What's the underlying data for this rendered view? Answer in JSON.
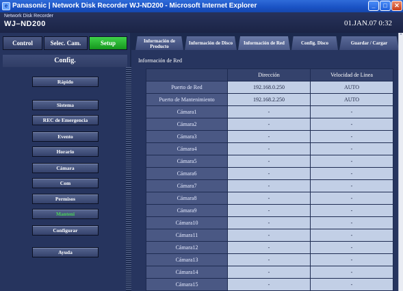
{
  "window": {
    "title": "Panasonic | Network Disk Recorder WJ-ND200 - Microsoft Internet Explorer",
    "min_glyph": "_",
    "max_glyph": "□",
    "close_glyph": "✕"
  },
  "header": {
    "product_line": "Network Disk Recorder",
    "model": "WJ–ND200",
    "datetime": "01.JAN.07  0:32"
  },
  "modes": {
    "control": "Control",
    "selec_cam": "Selec. Cam.",
    "setup": "Setup"
  },
  "sidebar": {
    "title": "Config.",
    "items": [
      {
        "label": "Rápido",
        "active": false
      },
      {
        "label": "Sistema",
        "active": false
      },
      {
        "label": "REC de Emergencia",
        "active": false
      },
      {
        "label": "Evento",
        "active": false
      },
      {
        "label": "Horario",
        "active": false
      },
      {
        "label": "Cámara",
        "active": false
      },
      {
        "label": "Com",
        "active": false
      },
      {
        "label": "Permisos",
        "active": false
      },
      {
        "label": "Manteni",
        "active": true
      },
      {
        "label": "Configurar",
        "active": false
      },
      {
        "label": "Ayuda",
        "active": false
      }
    ]
  },
  "tabs": {
    "producto_line1": "Información de",
    "producto_line2": "Producto",
    "disco": "Información de Disco",
    "red": "Información de Red",
    "config_disco": "Config. Disco",
    "guardar": "Guardar / Cargar",
    "active": "red"
  },
  "network": {
    "section_title": "Información de Red",
    "columns": [
      "",
      "Dirección",
      "Velocidad de Linea"
    ],
    "rows": [
      {
        "label": "Puerto de Red",
        "address": "192.168.0.250",
        "speed": "AUTO"
      },
      {
        "label": "Puerto de Mantenimiento",
        "address": "192.168.2.250",
        "speed": "AUTO"
      },
      {
        "label": "Cámara1",
        "address": "-",
        "speed": "-"
      },
      {
        "label": "Cámara2",
        "address": "-",
        "speed": "-"
      },
      {
        "label": "Cámara3",
        "address": "-",
        "speed": "-"
      },
      {
        "label": "Cámara4",
        "address": "-",
        "speed": "-"
      },
      {
        "label": "Cámara5",
        "address": "-",
        "speed": "-"
      },
      {
        "label": "Cámara6",
        "address": "-",
        "speed": "-"
      },
      {
        "label": "Cámara7",
        "address": "-",
        "speed": "-"
      },
      {
        "label": "Cámara8",
        "address": "-",
        "speed": "-"
      },
      {
        "label": "Cámara9",
        "address": "-",
        "speed": "-"
      },
      {
        "label": "Cámara10",
        "address": "-",
        "speed": "-"
      },
      {
        "label": "Cámara11",
        "address": "-",
        "speed": "-"
      },
      {
        "label": "Cámara12",
        "address": "-",
        "speed": "-"
      },
      {
        "label": "Cámara13",
        "address": "-",
        "speed": "-"
      },
      {
        "label": "Cámara14",
        "address": "-",
        "speed": "-"
      },
      {
        "label": "Cámara15",
        "address": "-",
        "speed": "-"
      }
    ]
  },
  "scroll_up_glyph": "^"
}
